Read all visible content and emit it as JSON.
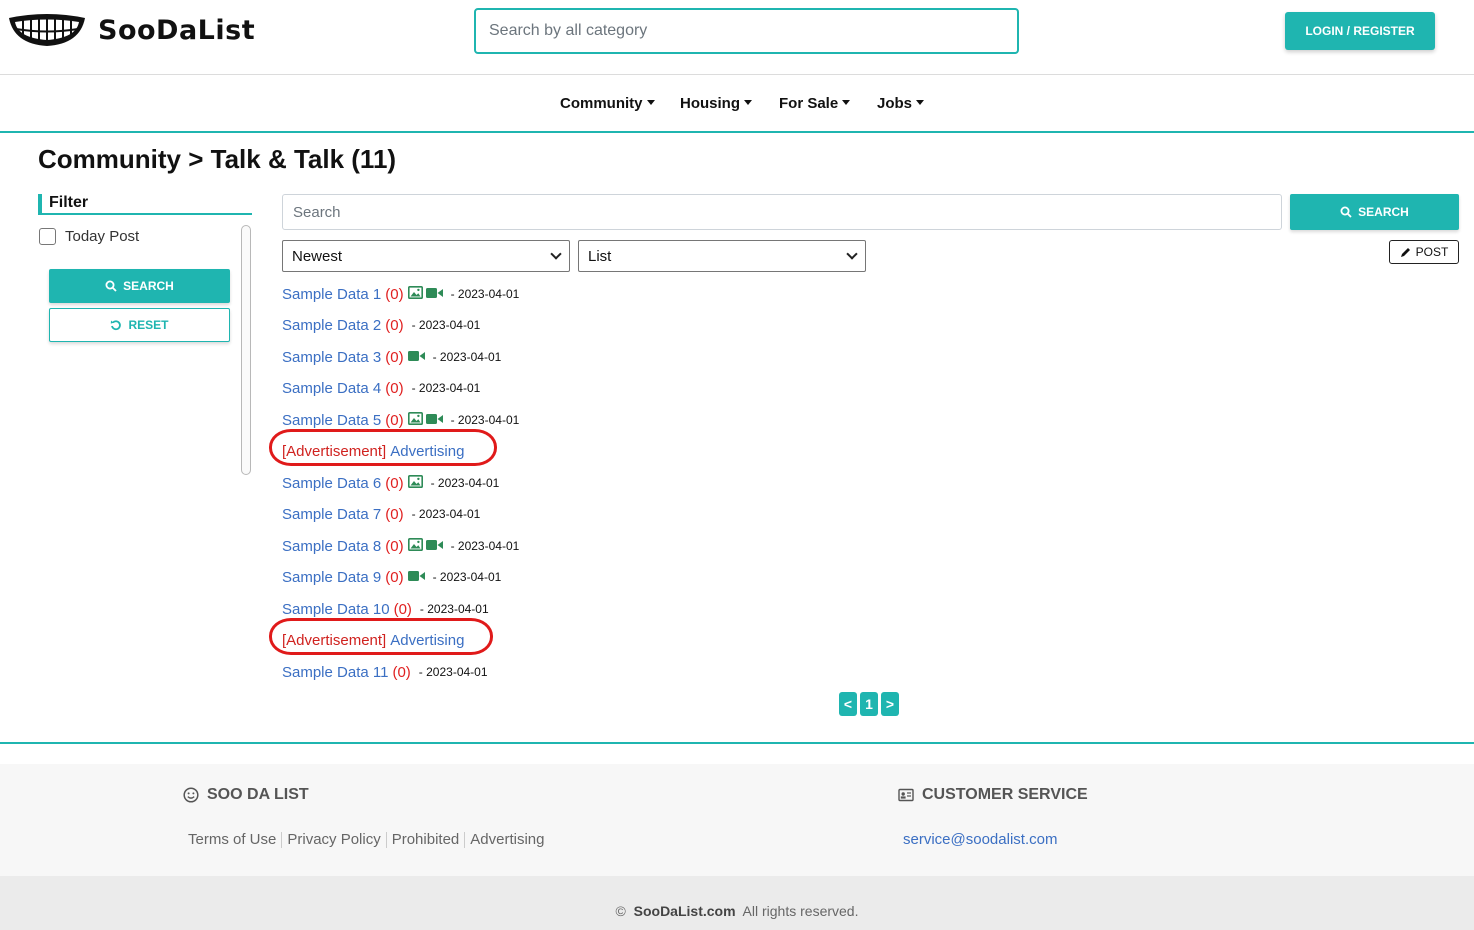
{
  "header": {
    "logo_text": "SooDaList",
    "search_placeholder": "Search by all category",
    "login_label": "LOGIN / REGISTER"
  },
  "nav": {
    "items": [
      {
        "label": "Community"
      },
      {
        "label": "Housing"
      },
      {
        "label": "For Sale"
      },
      {
        "label": "Jobs"
      }
    ]
  },
  "page": {
    "title": "Community > Talk & Talk (11)"
  },
  "sidebar": {
    "filter_title": "Filter",
    "today_post_label": "Today Post",
    "today_post_checked": false,
    "search_label": "SEARCH",
    "reset_label": "RESET"
  },
  "toolbar": {
    "search_placeholder": "Search",
    "search_label": "SEARCH",
    "sort_value": "Newest",
    "view_value": "List",
    "post_label": "POST"
  },
  "posts": [
    {
      "kind": "post",
      "title": "Sample Data 1",
      "count": "(0)",
      "icons": [
        "image",
        "video"
      ],
      "date": "- 2023-04-01"
    },
    {
      "kind": "post",
      "title": "Sample Data 2",
      "count": "(0)",
      "icons": [],
      "date": "- 2023-04-01"
    },
    {
      "kind": "post",
      "title": "Sample Data 3",
      "count": "(0)",
      "icons": [
        "video"
      ],
      "date": "- 2023-04-01"
    },
    {
      "kind": "post",
      "title": "Sample Data 4",
      "count": "(0)",
      "icons": [],
      "date": "- 2023-04-01"
    },
    {
      "kind": "post",
      "title": "Sample Data 5",
      "count": "(0)",
      "icons": [
        "image",
        "video"
      ],
      "date": "- 2023-04-01"
    },
    {
      "kind": "ad",
      "tag": "[Advertisement]",
      "title": "Advertising"
    },
    {
      "kind": "post",
      "title": "Sample Data 6",
      "count": "(0)",
      "icons": [
        "image"
      ],
      "date": "- 2023-04-01"
    },
    {
      "kind": "post",
      "title": "Sample Data 7",
      "count": "(0)",
      "icons": [],
      "date": "- 2023-04-01"
    },
    {
      "kind": "post",
      "title": "Sample Data 8",
      "count": "(0)",
      "icons": [
        "image",
        "video"
      ],
      "date": "- 2023-04-01"
    },
    {
      "kind": "post",
      "title": "Sample Data 9",
      "count": "(0)",
      "icons": [
        "video"
      ],
      "date": "- 2023-04-01"
    },
    {
      "kind": "post",
      "title": "Sample Data 10",
      "count": "(0)",
      "icons": [],
      "date": "- 2023-04-01"
    },
    {
      "kind": "ad",
      "tag": "[Advertisement]",
      "title": "Advertising"
    },
    {
      "kind": "post",
      "title": "Sample Data 11",
      "count": "(0)",
      "icons": [],
      "date": "- 2023-04-01"
    }
  ],
  "pagination": {
    "prev": "<",
    "current": "1",
    "next": ">"
  },
  "footer": {
    "brand_heading": "SOO DA LIST",
    "service_heading": "CUSTOMER SERVICE",
    "links": [
      "Terms of Use",
      "Privacy Policy",
      "Prohibited",
      "Advertising"
    ],
    "email": "service@soodalist.com",
    "copyright_symbol": "©",
    "copyright_site": "SooDaList.com",
    "copyright_rest": "All rights reserved."
  },
  "colors": {
    "accent": "#1fb5b0",
    "link": "#3b6fc3",
    "count": "#e02020",
    "ad_highlight": "#e01a1a"
  }
}
